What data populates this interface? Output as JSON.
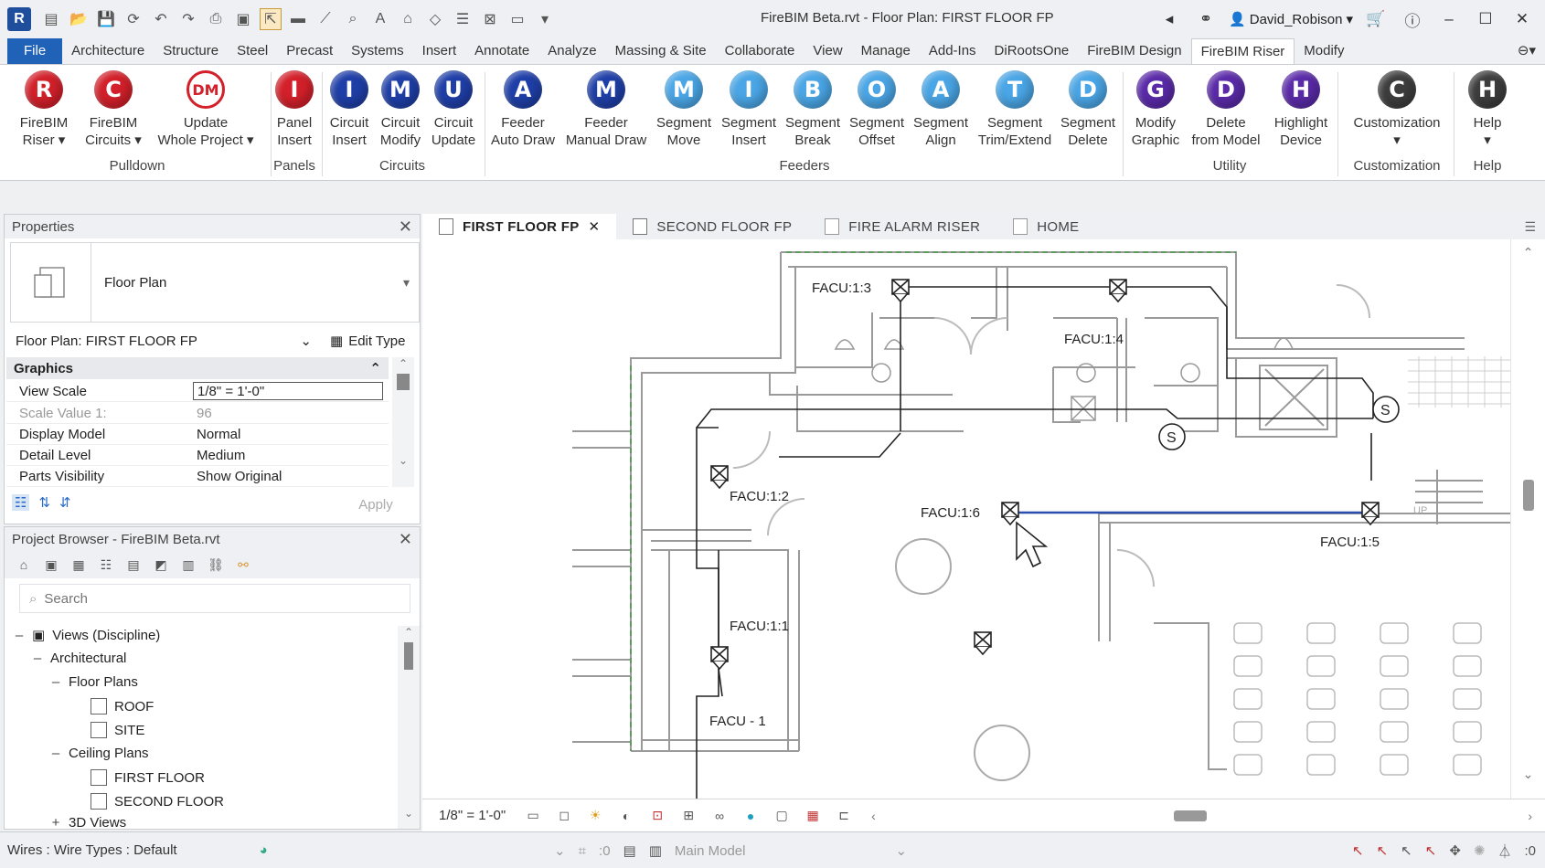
{
  "titlebar": {
    "title": "FireBIM Beta.rvt - Floor Plan: FIRST FLOOR FP",
    "user": "David_Robison"
  },
  "menu": [
    "File",
    "Architecture",
    "Structure",
    "Steel",
    "Precast",
    "Systems",
    "Insert",
    "Annotate",
    "Analyze",
    "Massing & Site",
    "Collaborate",
    "View",
    "Manage",
    "Add-Ins",
    "DiRootsOne",
    "FireBIM Design",
    "FireBIM Riser",
    "Modify"
  ],
  "ribbon": {
    "buttons": [
      {
        "letter": "R",
        "label": "FireBIM\nRiser"
      },
      {
        "letter": "C",
        "label": "FireBIM\nCircuits"
      },
      {
        "letter": "DM",
        "label": "Update\nWhole Project"
      },
      {
        "letter": "I",
        "label": "Panel\nInsert"
      },
      {
        "letter": "I",
        "label": "Circuit\nInsert"
      },
      {
        "letter": "M",
        "label": "Circuit\nModify"
      },
      {
        "letter": "U",
        "label": "Circuit\nUpdate"
      },
      {
        "letter": "A",
        "label": "Feeder\nAuto Draw"
      },
      {
        "letter": "M",
        "label": "Feeder\nManual Draw"
      },
      {
        "letter": "M",
        "label": "Segment\nMove"
      },
      {
        "letter": "I",
        "label": "Segment\nInsert"
      },
      {
        "letter": "B",
        "label": "Segment\nBreak"
      },
      {
        "letter": "O",
        "label": "Segment\nOffset"
      },
      {
        "letter": "A",
        "label": "Segment\nAlign"
      },
      {
        "letter": "T",
        "label": "Segment\nTrim/Extend"
      },
      {
        "letter": "D",
        "label": "Segment\nDelete"
      },
      {
        "letter": "G",
        "label": "Modify\nGraphic"
      },
      {
        "letter": "D",
        "label": "Delete\nfrom Model"
      },
      {
        "letter": "H",
        "label": "Highlight\nDevice"
      },
      {
        "letter": "C",
        "label": "Customization"
      },
      {
        "letter": "H",
        "label": "Help"
      }
    ],
    "groups": [
      "Pulldown",
      "Panels",
      "Circuits",
      "Feeders",
      "Utility",
      "Customization",
      "Help"
    ]
  },
  "properties": {
    "title": "Properties",
    "type_name": "Floor Plan",
    "selector": "Floor Plan: FIRST FLOOR FP",
    "edit_type": "Edit Type",
    "section": "Graphics",
    "rows": [
      {
        "k": "View Scale",
        "v": "1/8\" = 1'-0\""
      },
      {
        "k": "Scale Value    1:",
        "v": "96"
      },
      {
        "k": "Display Model",
        "v": "Normal"
      },
      {
        "k": "Detail Level",
        "v": "Medium"
      },
      {
        "k": "Parts Visibility",
        "v": "Show Original"
      }
    ],
    "apply": "Apply"
  },
  "browser": {
    "title": "Project Browser - FireBIM Beta.rvt",
    "search_placeholder": "Search",
    "tree": [
      {
        "t": "Views (Discipline)"
      },
      {
        "t": "Architectural"
      },
      {
        "t": "Floor Plans"
      },
      {
        "t": "ROOF"
      },
      {
        "t": "SITE"
      },
      {
        "t": "Ceiling Plans"
      },
      {
        "t": "FIRST FLOOR"
      },
      {
        "t": "SECOND FLOOR"
      },
      {
        "t": "3D Views"
      }
    ]
  },
  "viewtabs": [
    "FIRST FLOOR FP",
    "SECOND FLOOR FP",
    "FIRE ALARM RISER",
    "HOME"
  ],
  "canvas": {
    "labels": [
      "FACU:1:3",
      "FACU:1:4",
      "FACU:1:2",
      "FACU:1:6",
      "FACU:1:5",
      "FACU:1:1",
      "FACU - 1",
      "S",
      "S",
      "UP"
    ]
  },
  "viewbar": {
    "scale": "1/8\" = 1'-0\""
  },
  "status": {
    "left": "Wires : Wire Types : Default",
    "zero1": ":0",
    "model": "Main Model",
    "zero2": ":0"
  },
  "colors": {
    "file_tab": "#1f62b8",
    "red": "#d3202a",
    "blue": "#1f3fa8",
    "light_blue": "#4aa6e6",
    "purple": "#5a2aa8"
  }
}
